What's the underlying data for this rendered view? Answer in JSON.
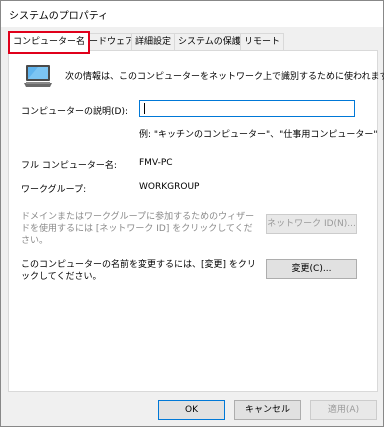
{
  "window": {
    "title": "システムのプロパティ"
  },
  "tabs": [
    {
      "label": "コンピューター名",
      "active": true
    },
    {
      "label": "ハードウェア"
    },
    {
      "label": "詳細設定"
    },
    {
      "label": "システムの保護"
    },
    {
      "label": "リモート"
    }
  ],
  "intro": "次の情報は、このコンピューターをネットワーク上で識別するために使われます。",
  "description": {
    "label": "コンピューターの説明(D):",
    "value": "",
    "example": "例: \"キッチンのコンピューター\"、\"仕事用コンピューター\""
  },
  "full_name": {
    "label": "フル コンピューター名:",
    "value": "FMV-PC"
  },
  "workgroup": {
    "label": "ワークグループ:",
    "value": "WORKGROUP"
  },
  "network_id": {
    "text": "ドメインまたはワークグループに参加するためのウィザードを使用するには [ネットワーク ID] をクリックしてください。",
    "button": "ネットワーク ID(N)..."
  },
  "change": {
    "text": "このコンピューターの名前を変更するには、[変更] をクリックしてください。",
    "button": "変更(C)..."
  },
  "footer": {
    "ok": "OK",
    "cancel": "キャンセル",
    "apply": "適用(A)"
  },
  "colors": {
    "highlight": "#e0001b",
    "focus": "#0078d7"
  }
}
